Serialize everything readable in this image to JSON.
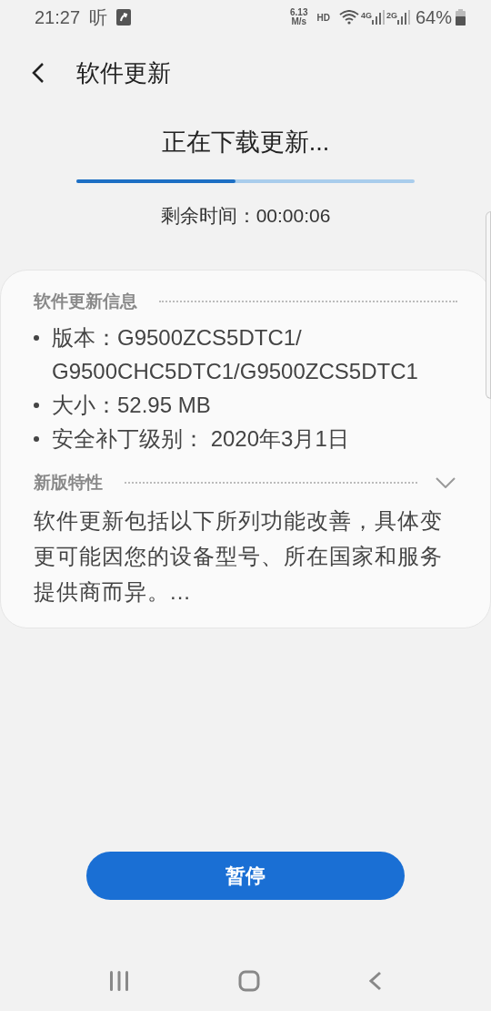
{
  "status_bar": {
    "time": "21:27",
    "app_glyph": "听",
    "speed": [
      "6.13",
      "M/s"
    ],
    "hd": "HD",
    "networks": [
      "4G",
      "2G"
    ],
    "battery": "64%"
  },
  "header": {
    "title": "软件更新"
  },
  "download": {
    "status": "正在下载更新...",
    "level": 0.47,
    "remaining": "剩余时间：00:00:06"
  },
  "info": {
    "heading": "软件更新信息",
    "items": [
      "版本：G9500ZCS5DTC1/G9500CHC5DTC1/G9500ZCS5DTC1",
      "大小：52.95 MB",
      "安全补丁级别： 2020年3月1日"
    ]
  },
  "features": {
    "heading": "新版特性",
    "expanded": false,
    "text": "软件更新包括以下所列功能改善，具体变更可能因您的设备型号、所在国家和服务提供商而异。..."
  },
  "pause_button": "暂停"
}
